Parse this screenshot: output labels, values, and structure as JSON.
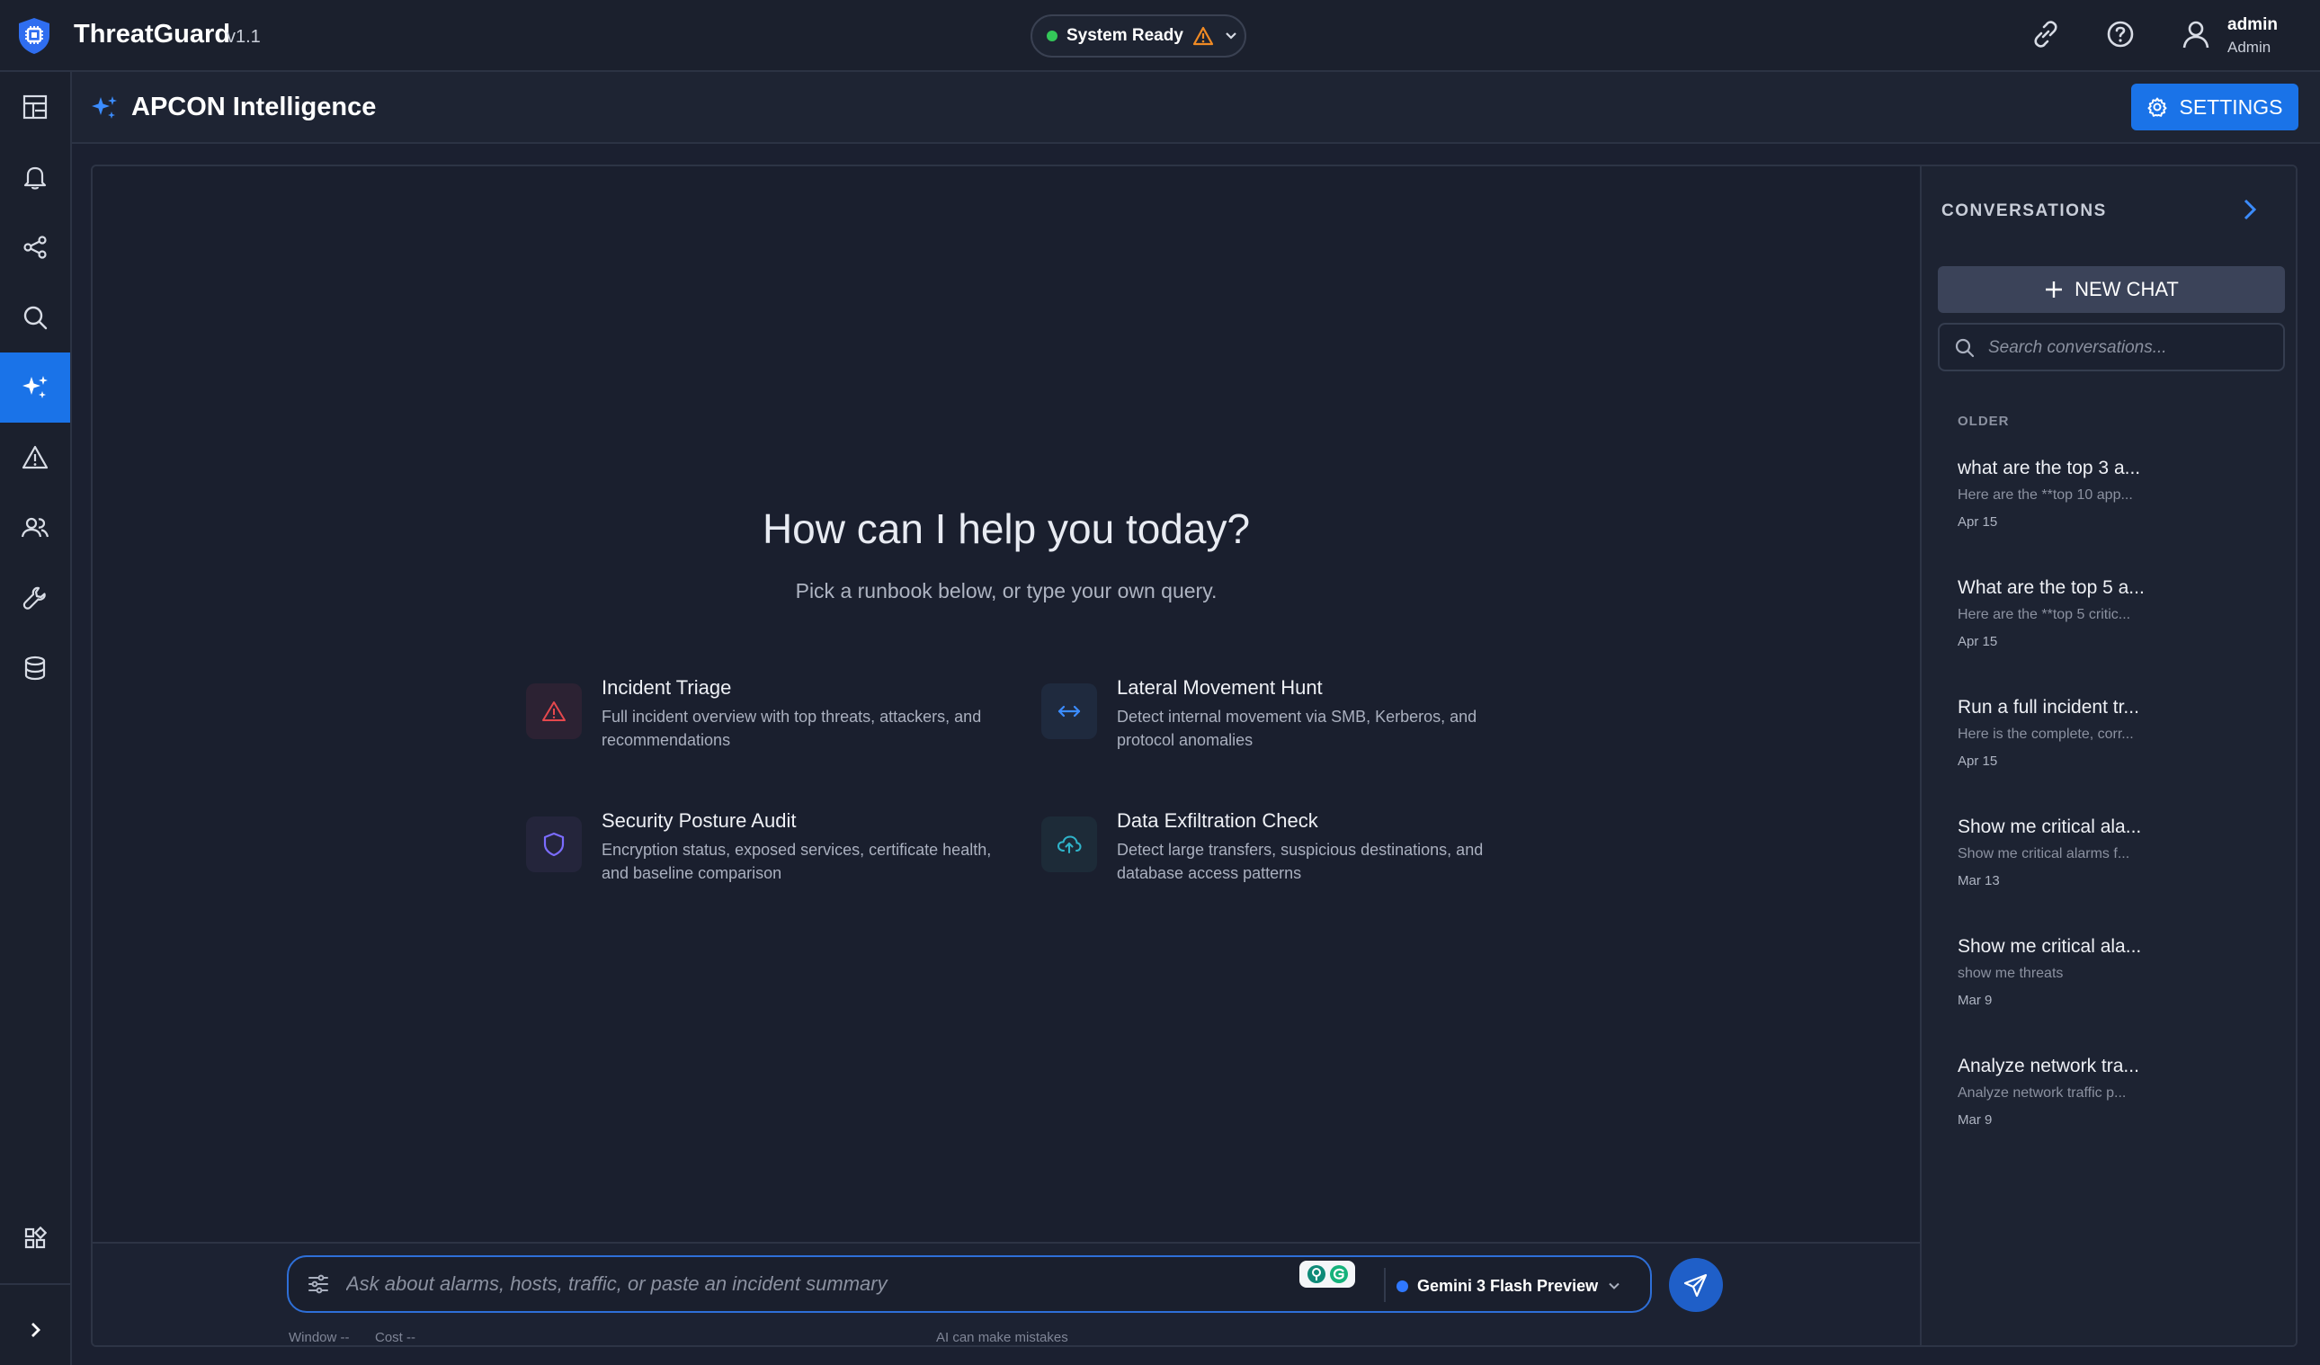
{
  "app": {
    "name": "ThreatGuard",
    "version": "v1.1",
    "status": "System Ready"
  },
  "user": {
    "name": "admin",
    "role": "Admin"
  },
  "page": {
    "title": "APCON Intelligence",
    "settings_label": "SETTINGS"
  },
  "hero": {
    "title": "How can I help you today?",
    "subtitle": "Pick a runbook below, or type your own query."
  },
  "runbooks": [
    {
      "title": "Incident Triage",
      "description": "Full incident overview with top threats, attackers, and recommendations",
      "icon": "warning-icon",
      "color": "#e5484d"
    },
    {
      "title": "Lateral Movement Hunt",
      "description": "Detect internal movement via SMB, Kerberos, and protocol anomalies",
      "icon": "arrows-horizontal-icon",
      "color": "#3b8cff"
    },
    {
      "title": "Security Posture Audit",
      "description": "Encryption status, exposed services, certificate health, and baseline comparison",
      "icon": "shield-icon",
      "color": "#7b6cff"
    },
    {
      "title": "Data Exfiltration Check",
      "description": "Detect large transfers, suspicious destinations, and database access patterns",
      "icon": "cloud-upload-icon",
      "color": "#2fb3c9"
    }
  ],
  "composer": {
    "placeholder": "Ask about alarms, hosts, traffic, or paste an incident summary",
    "model": "Gemini 3 Flash Preview",
    "window_label": "Window --",
    "cost_label": "Cost --",
    "disclaimer": "AI can make mistakes"
  },
  "conversations": {
    "title": "CONVERSATIONS",
    "new_chat_label": "NEW CHAT",
    "search_placeholder": "Search conversations...",
    "group_label": "OLDER",
    "items": [
      {
        "title": "what are the top 3 a...",
        "preview": "Here are the **top 10 app...",
        "date": "Apr 15"
      },
      {
        "title": "What are the top 5 a...",
        "preview": "Here are the **top 5 critic...",
        "date": "Apr 15"
      },
      {
        "title": "Run a full incident tr...",
        "preview": "Here is the complete, corr...",
        "date": "Apr 15"
      },
      {
        "title": "Show me critical ala...",
        "preview": "Show me critical alarms f...",
        "date": "Mar 13"
      },
      {
        "title": "Show me critical ala...",
        "preview": "show me threats",
        "date": "Mar 9"
      },
      {
        "title": "Analyze network tra...",
        "preview": "Analyze network traffic p...",
        "date": "Mar 9"
      }
    ]
  },
  "colors": {
    "accent": "#1a73e8",
    "status_ok": "#34c759",
    "warning": "#f08a24"
  }
}
